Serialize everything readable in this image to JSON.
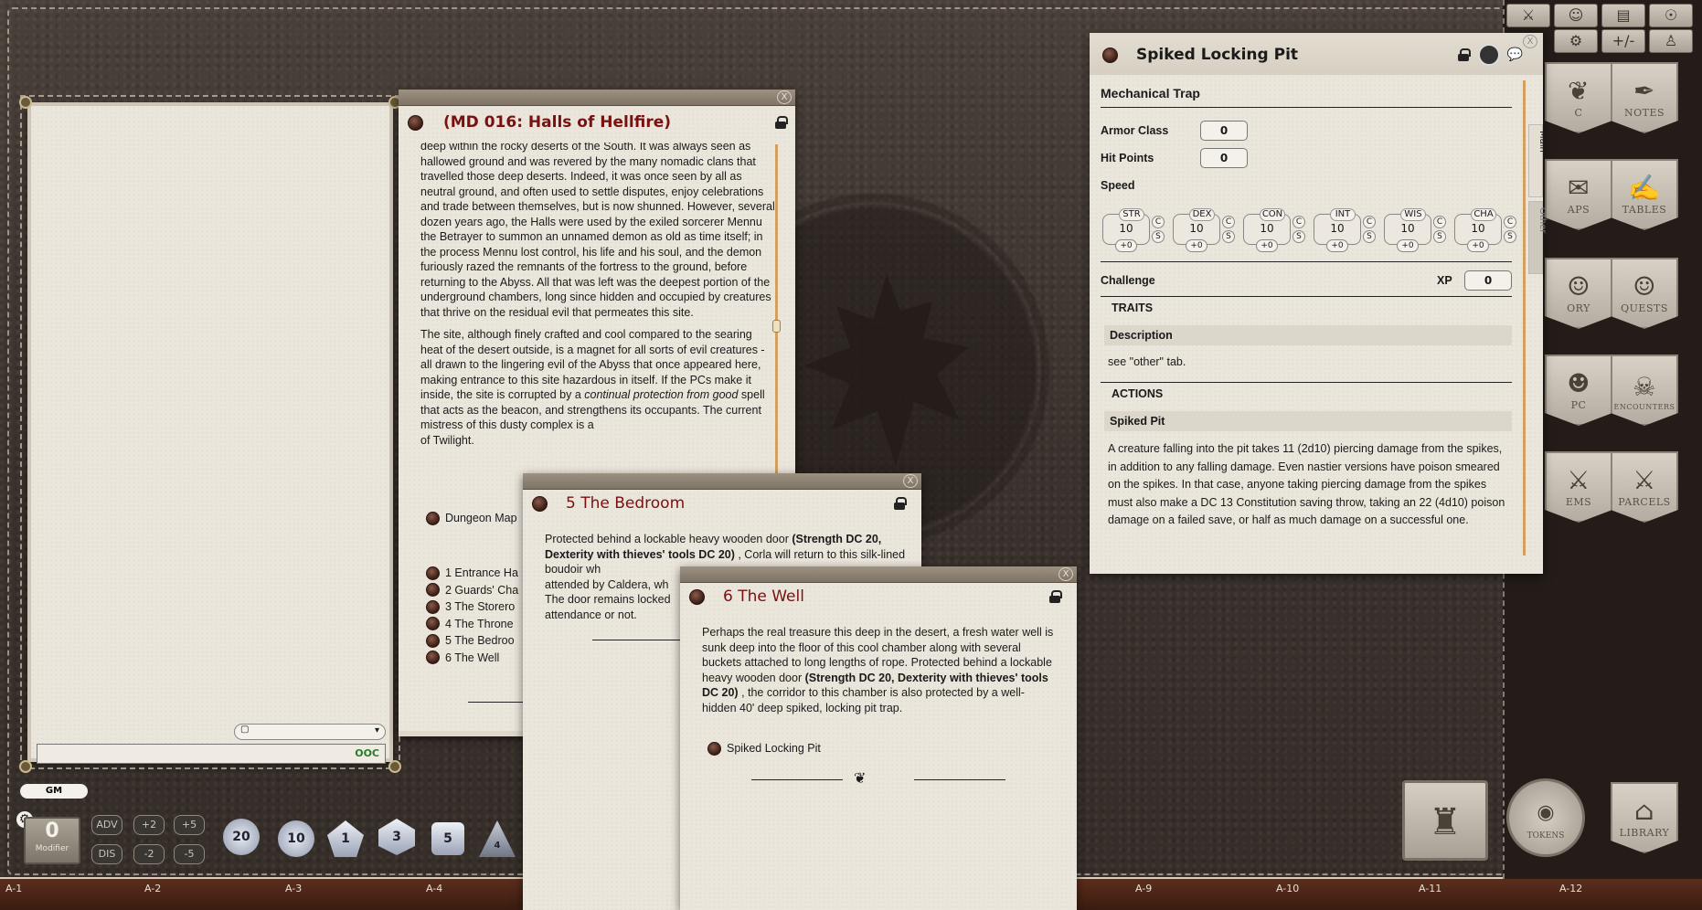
{
  "story_window": {
    "title": "(MD 016: Halls of Hellfire)",
    "paragraph1": "deep within the rocky deserts of the South. It was always seen as hallowed ground and was revered by the many nomadic clans that travelled those deep deserts. Indeed, it was once seen by all as neutral ground, and often used to settle disputes, enjoy celebrations and trade between themselves, but is now shunned. However, several dozen years ago, the Halls were used by the exiled sorcerer Mennu the Betrayer to summon an unnamed demon as old as time itself; in the process Mennu lost control, his life and his soul, and the demon furiously razed the remnants of the fortress to the ground, before returning to the Abyss. All that was left was the deepest portion of the underground chambers, long since hidden and occupied by creatures that thrive on the residual evil that permeates this site.",
    "paragraph2_a": "The site, although finely crafted and cool compared to the searing heat of the desert outside, is a magnet for all sorts of evil creatures - all drawn to the lingering evil of the Abyss that once appeared here, making entrance to this site hazardous in itself. If the PCs make it inside, the site is corrupted by a ",
    "paragraph2_italic": "continual protection from good",
    "paragraph2_b": " spell that acts as the beacon, and strengthens its occupants. The current mistress of this dusty complex is a",
    "paragraph2_tail": "of Twilight.",
    "map_link": "Dungeon Map",
    "room_links": [
      "1 Entrance Ha",
      "2 Guards' Cha",
      "3 The Storero",
      "4 The Throne",
      "5 The Bedroo",
      "6 The Well"
    ]
  },
  "bedroom_window": {
    "title": "5 The Bedroom",
    "text_a": "Protected behind a lockable heavy wooden door ",
    "text_bold": "(Strength DC 20, Dexterity with thieves' tools DC 20)",
    "text_b": " , Corla will return to this silk-lined boudoir wh",
    "line3": "attended by Caldera, wh",
    "line4": "The door remains locked",
    "line5": "attendance or not."
  },
  "well_window": {
    "title": "6 The Well",
    "text_a": "Perhaps the real treasure this deep in the desert, a fresh water well is sunk deep into the floor of this cool chamber along with several buckets attached to long lengths of rope. Protected behind a lockable heavy wooden door ",
    "text_bold": "(Strength DC 20, Dexterity with thieves' tools DC 20)",
    "text_b": " , the corridor to this chamber is also protected by a well-hidden 40' deep spiked, locking pit trap.",
    "link": "Spiked Locking Pit"
  },
  "trap_window": {
    "title": "Spiked Locking Pit",
    "type": "Mechanical Trap",
    "armor_class_label": "Armor Class",
    "armor_class": "0",
    "hit_points_label": "Hit Points",
    "hit_points": "0",
    "speed_label": "Speed",
    "abilities": [
      {
        "name": "STR",
        "score": "10",
        "mod": "+0"
      },
      {
        "name": "DEX",
        "score": "10",
        "mod": "+0"
      },
      {
        "name": "CON",
        "score": "10",
        "mod": "+0"
      },
      {
        "name": "INT",
        "score": "10",
        "mod": "+0"
      },
      {
        "name": "WIS",
        "score": "10",
        "mod": "+0"
      },
      {
        "name": "CHA",
        "score": "10",
        "mod": "+0"
      }
    ],
    "c_label": "C",
    "s_label": "S",
    "challenge_label": "Challenge",
    "xp_label": "XP",
    "xp": "0",
    "traits_header": "TRAITS",
    "trait_name": "Description",
    "trait_text": "see \"other\" tab.",
    "actions_header": "ACTIONS",
    "action_name": "Spiked Pit",
    "action_text": "A creature falling into the pit takes 11 (2d10) piercing damage from the spikes, in addition to any falling damage. Even nastier versions have poison smeared on the spikes. In that case, anyone taking piercing damage from the spikes must also make a DC 13 Constitution saving throw, taking an 22 (4d10) poison damage on a failed save, or half as much damage on a successful one.",
    "tab_main": "Main",
    "tab_other": "Other"
  },
  "chat": {
    "gm_label": "GM",
    "ooc_label": "OOC"
  },
  "modifier": {
    "value": "0",
    "label": "Modifier",
    "buttons": [
      "ADV",
      "+2",
      "+5",
      "DIS",
      "-2",
      "-5"
    ]
  },
  "dice": [
    "20",
    "10",
    "1",
    "3",
    "5",
    "4"
  ],
  "sidebar_tabs": [
    "NOTES",
    "TABLES",
    "QUESTS",
    "ENCOUNTERS",
    "PARCELS",
    "LIBRARY",
    "TOKENS"
  ],
  "sidebar_partial_tabs": [
    "C",
    "APS",
    "ORY",
    "PC",
    "EMS"
  ],
  "top_buttons": [
    "+/-"
  ],
  "grid_labels": [
    "A-1",
    "A-2",
    "A-3",
    "A-4",
    "A-9",
    "A-10",
    "A-11",
    "A-12"
  ],
  "colors": {
    "title_red": "#7a1010",
    "paper": "#ebe6dc",
    "leather": "#3b322d"
  }
}
